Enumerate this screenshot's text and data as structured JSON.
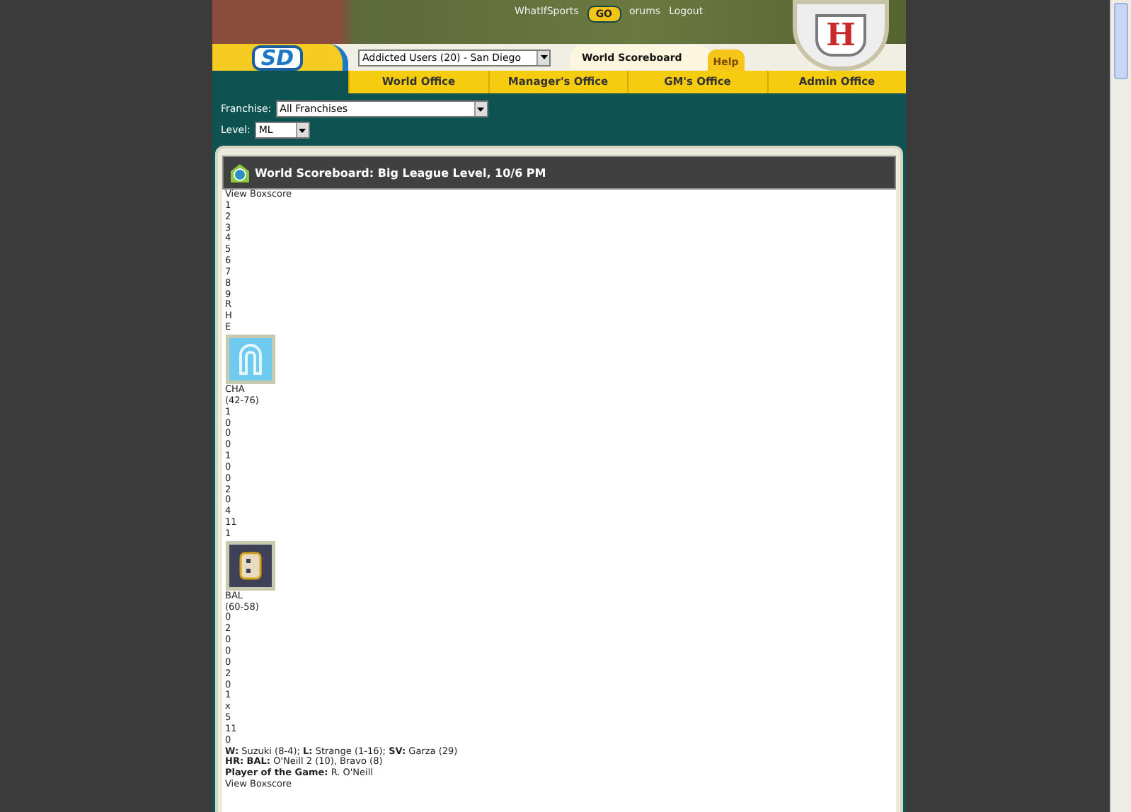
{
  "header": {
    "top_links": [
      "WhatIfSports",
      "orums",
      "Logout"
    ],
    "go_button": "GO",
    "logo_text": "SD",
    "crest_letter": "H",
    "team_select": "Addicted Users (20) - San Diego",
    "page_tab": "World Scoreboard",
    "help_tab": "Help"
  },
  "nav": [
    "World Office",
    "Manager's Office",
    "GM's Office",
    "Admin Office"
  ],
  "filters": {
    "franchise_label": "Franchise:",
    "franchise": "All Franchises",
    "level_label": "Level:",
    "level": "ML"
  },
  "panel": {
    "title": "World Scoreboard: Big League Level, 10/6 PM",
    "game": {
      "view_boxscore": "View Boxscore",
      "columns": [
        "1",
        "2",
        "3",
        "4",
        "5",
        "6",
        "7",
        "8",
        "9",
        "R",
        "H",
        "E"
      ],
      "teams": [
        {
          "kind": "arch",
          "abbr": "CHA",
          "record": "(42-76)",
          "scores": [
            "1",
            "0",
            "0",
            "0",
            "1",
            "0",
            "0",
            "2",
            "0",
            "4",
            "11",
            "1"
          ]
        },
        {
          "kind": "block",
          "abbr": "BAL",
          "record": "(60-58)",
          "scores": [
            "0",
            "2",
            "0",
            "0",
            "0",
            "2",
            "0",
            "1",
            "x",
            "5",
            "11",
            "0"
          ]
        }
      ],
      "summary": [
        "**W:** Suzuki (8-4); **L:** Strange (1-16); **SV:** Garza (29)",
        "**HR: BAL:** O'Neill 2 (10), Bravo (8)",
        "**Player of the Game:** R. O'Neill"
      ],
      "next_link": "View Boxscore"
    }
  }
}
